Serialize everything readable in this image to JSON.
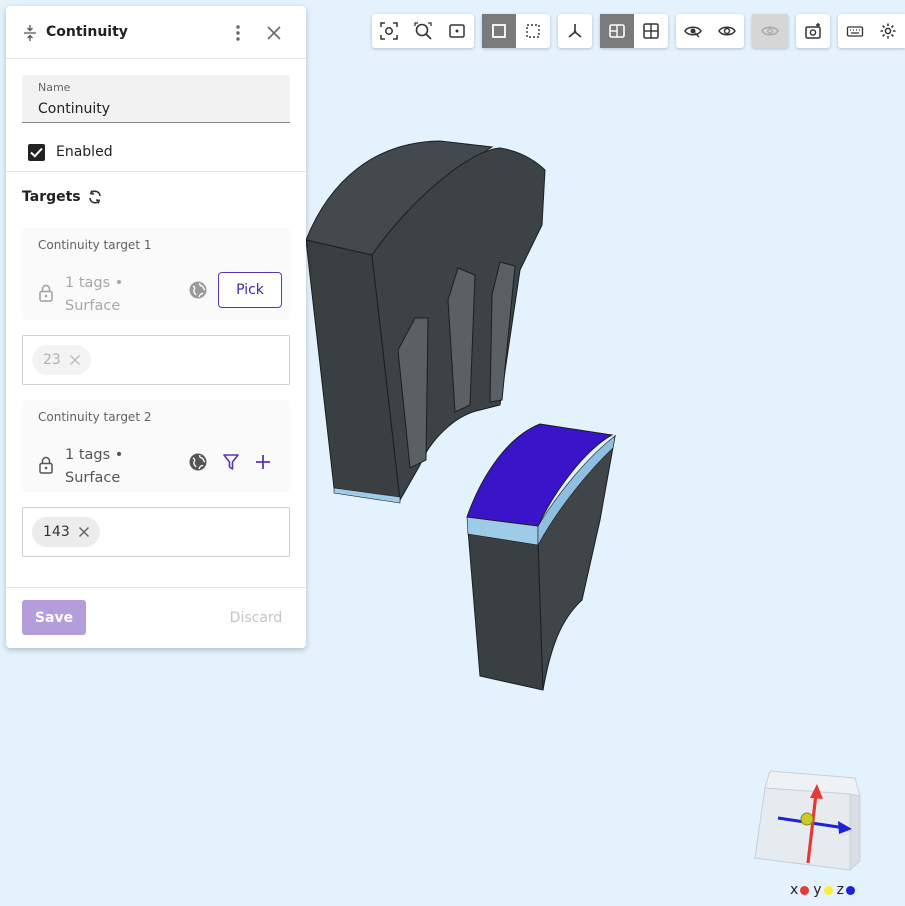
{
  "panel": {
    "title": "Continuity",
    "name_field": {
      "label": "Name",
      "value": "Continuity"
    },
    "enabled_label": "Enabled",
    "enabled": true,
    "targets_title": "Targets",
    "targets": [
      {
        "title": "Continuity target 1",
        "tags_line1": "1 tags •",
        "tags_line2": "Surface",
        "pick_label": "Pick",
        "chips": [
          "23"
        ]
      },
      {
        "title": "Continuity target 2",
        "tags_line1": "1 tags •",
        "tags_line2": "Surface",
        "chips": [
          "143"
        ]
      }
    ],
    "save_label": "Save",
    "discard_label": "Discard"
  },
  "toolbar": {
    "groups": [
      [
        "zoom-to-fit-icon",
        "zoom-to-selection-icon",
        "frame-icon"
      ],
      [
        "solid-view-icon",
        "wireframe-view-icon"
      ],
      [
        "axes-icon"
      ],
      [
        "section-view-icon",
        "grid-view-icon"
      ],
      [
        "hide-icon",
        "show-icon"
      ],
      [
        "visibility-disabled-icon"
      ],
      [
        "screenshot-icon"
      ],
      [
        "keyboard-icon",
        "settings-icon"
      ]
    ],
    "active": [
      "solid-view-icon",
      "section-view-icon"
    ],
    "disabled": [
      "visibility-disabled-icon"
    ]
  },
  "axis_legend": [
    {
      "label": "x",
      "color": "#e53935"
    },
    {
      "label": "y",
      "color": "#ffeb3b"
    },
    {
      "label": "z",
      "color": "#1e22d6"
    }
  ],
  "colors": {
    "accent": "#5e35b1",
    "selected_face": "#3a14c8",
    "body_dark": "#3c4245",
    "viewport_bg": "#e3f2fd"
  }
}
